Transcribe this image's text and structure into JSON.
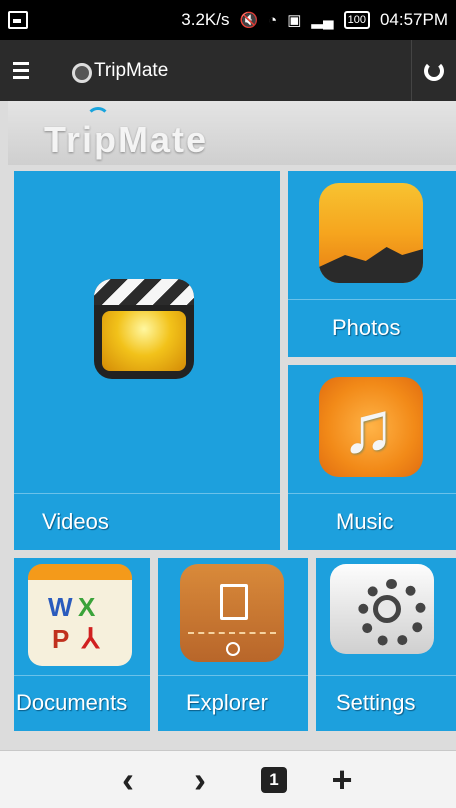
{
  "status_bar": {
    "speed": "3.2K/s",
    "battery": "100",
    "time": "04:57PM"
  },
  "app_bar": {
    "title": "TripMate"
  },
  "banner": {
    "logo_text": "TripMate"
  },
  "tiles": {
    "videos": "Videos",
    "photos": "Photos",
    "music": "Music",
    "documents": "Documents",
    "explorer": "Explorer",
    "settings": "Settings"
  },
  "bottom_nav": {
    "back": "‹",
    "forward": "›",
    "tab_count": "1",
    "add": "+"
  },
  "colors": {
    "tile_blue": "#1da0dd",
    "app_bar": "#2b2b2b"
  }
}
